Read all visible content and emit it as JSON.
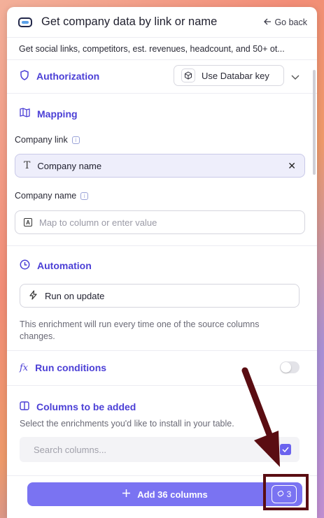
{
  "header": {
    "title": "Get company data by link or name",
    "go_back_label": "Go back",
    "description": "Get social links, competitors, est. revenues, headcount, and 50+ ot..."
  },
  "authorization": {
    "title": "Authorization",
    "key_button_label": "Use Databar key"
  },
  "mapping": {
    "title": "Mapping",
    "company_link_label": "Company link",
    "company_link_value": "Company name",
    "company_name_label": "Company name",
    "company_name_placeholder": "Map to column or enter value"
  },
  "automation": {
    "title": "Automation",
    "trigger_label": "Run on update",
    "help_text": "This enrichment will run every time one of the source columns changes."
  },
  "run_conditions": {
    "title": "Run conditions",
    "enabled": false
  },
  "columns": {
    "title": "Columns to be added",
    "subtitle": "Select the enrichments you'd like to install in your table.",
    "search_placeholder": "Search columns...",
    "select_all_checked": true
  },
  "footer": {
    "add_button_label": "Add 36 columns",
    "credits_value": "3"
  },
  "colors": {
    "accent": "#4b3fd6",
    "button": "#7a73f2",
    "arrow": "#5a0d12"
  }
}
